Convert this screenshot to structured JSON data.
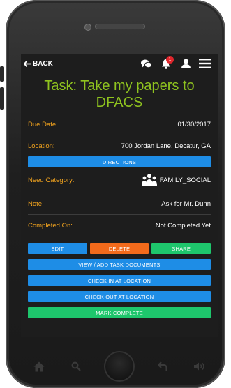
{
  "header": {
    "back_label": "BACK",
    "notification_count": "1"
  },
  "task": {
    "title": "Task: Take my papers to DFACS"
  },
  "fields": {
    "due_date": {
      "label": "Due Date:",
      "value": "01/30/2017"
    },
    "location": {
      "label": "Location:",
      "value": "700 Jordan Lane, Decatur, GA"
    },
    "need_category": {
      "label": "Need Category:",
      "value": "FAMILY_SOCIAL"
    },
    "note": {
      "label": "Note:",
      "value": "Ask for Mr. Dunn"
    },
    "completed_on": {
      "label": "Completed On:",
      "value": "Not Completed Yet"
    }
  },
  "buttons": {
    "directions": "DIRECTIONS",
    "edit": "EDIT",
    "delete": "DELETE",
    "share": "SHARE",
    "documents": "VIEW / ADD TASK DOCUMENTS",
    "check_in": "CHECK IN AT LOCATION",
    "check_out": "CHECK OUT AT LOCATION",
    "mark_complete": "MARK COMPLETE"
  },
  "colors": {
    "title": "#8fc31f",
    "label": "#f0a21e",
    "blue_button": "#1e8de6",
    "orange_button": "#f26a1b",
    "green_button": "#1ec66c",
    "badge": "#e0262c"
  },
  "icons": {
    "topbar": [
      "back-arrow-icon",
      "chat-icon",
      "bell-icon",
      "user-icon",
      "menu-icon"
    ],
    "category": "family-icon",
    "nav": [
      "home-icon",
      "search-icon",
      "phone-home-button",
      "back-icon",
      "volume-icon"
    ]
  }
}
